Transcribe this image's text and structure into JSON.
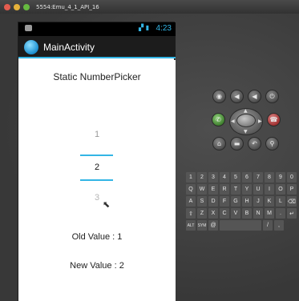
{
  "window": {
    "title": "5554:Emu_4_1_API_16"
  },
  "status_bar": {
    "time": "4:23"
  },
  "action_bar": {
    "title": "MainActivity"
  },
  "main": {
    "header": "Static NumberPicker",
    "picker": {
      "prev": "1",
      "current": "2",
      "next": "3"
    },
    "old_value": "Old Value : 1",
    "new_value": "New Value : 2"
  },
  "controls": {
    "row1": [
      "camera-icon",
      "volume-down-icon",
      "volume-up-icon",
      "power-icon"
    ],
    "row2": [
      "call-icon",
      "dpad-icon",
      "end-call-icon"
    ],
    "row3": [
      "home-icon",
      "menu-icon",
      "back-icon",
      "search-icon"
    ],
    "row1_glyphs": [
      "◉",
      "◀",
      "◀",
      "⏻"
    ],
    "row3_glyphs": [
      "⌂",
      "▬",
      "↶",
      "⚲"
    ]
  },
  "keyboard": {
    "row0": [
      "1",
      "2",
      "3",
      "4",
      "5",
      "6",
      "7",
      "8",
      "9",
      "0"
    ],
    "row1": [
      "Q",
      "W",
      "E",
      "R",
      "T",
      "Y",
      "U",
      "I",
      "O",
      "P"
    ],
    "row2": [
      "A",
      "S",
      "D",
      "F",
      "G",
      "H",
      "J",
      "K",
      "L",
      "⌫"
    ],
    "row3": [
      "⇧",
      "Z",
      "X",
      "C",
      "V",
      "B",
      "N",
      "M",
      ".",
      "↵"
    ],
    "row4": [
      "ALT",
      "SYM",
      "@",
      "",
      "/",
      ","
    ]
  },
  "colors": {
    "accent": "#33b5e5",
    "window_close": "#e45c4f",
    "window_min": "#e5b13a",
    "window_max": "#66b940"
  }
}
